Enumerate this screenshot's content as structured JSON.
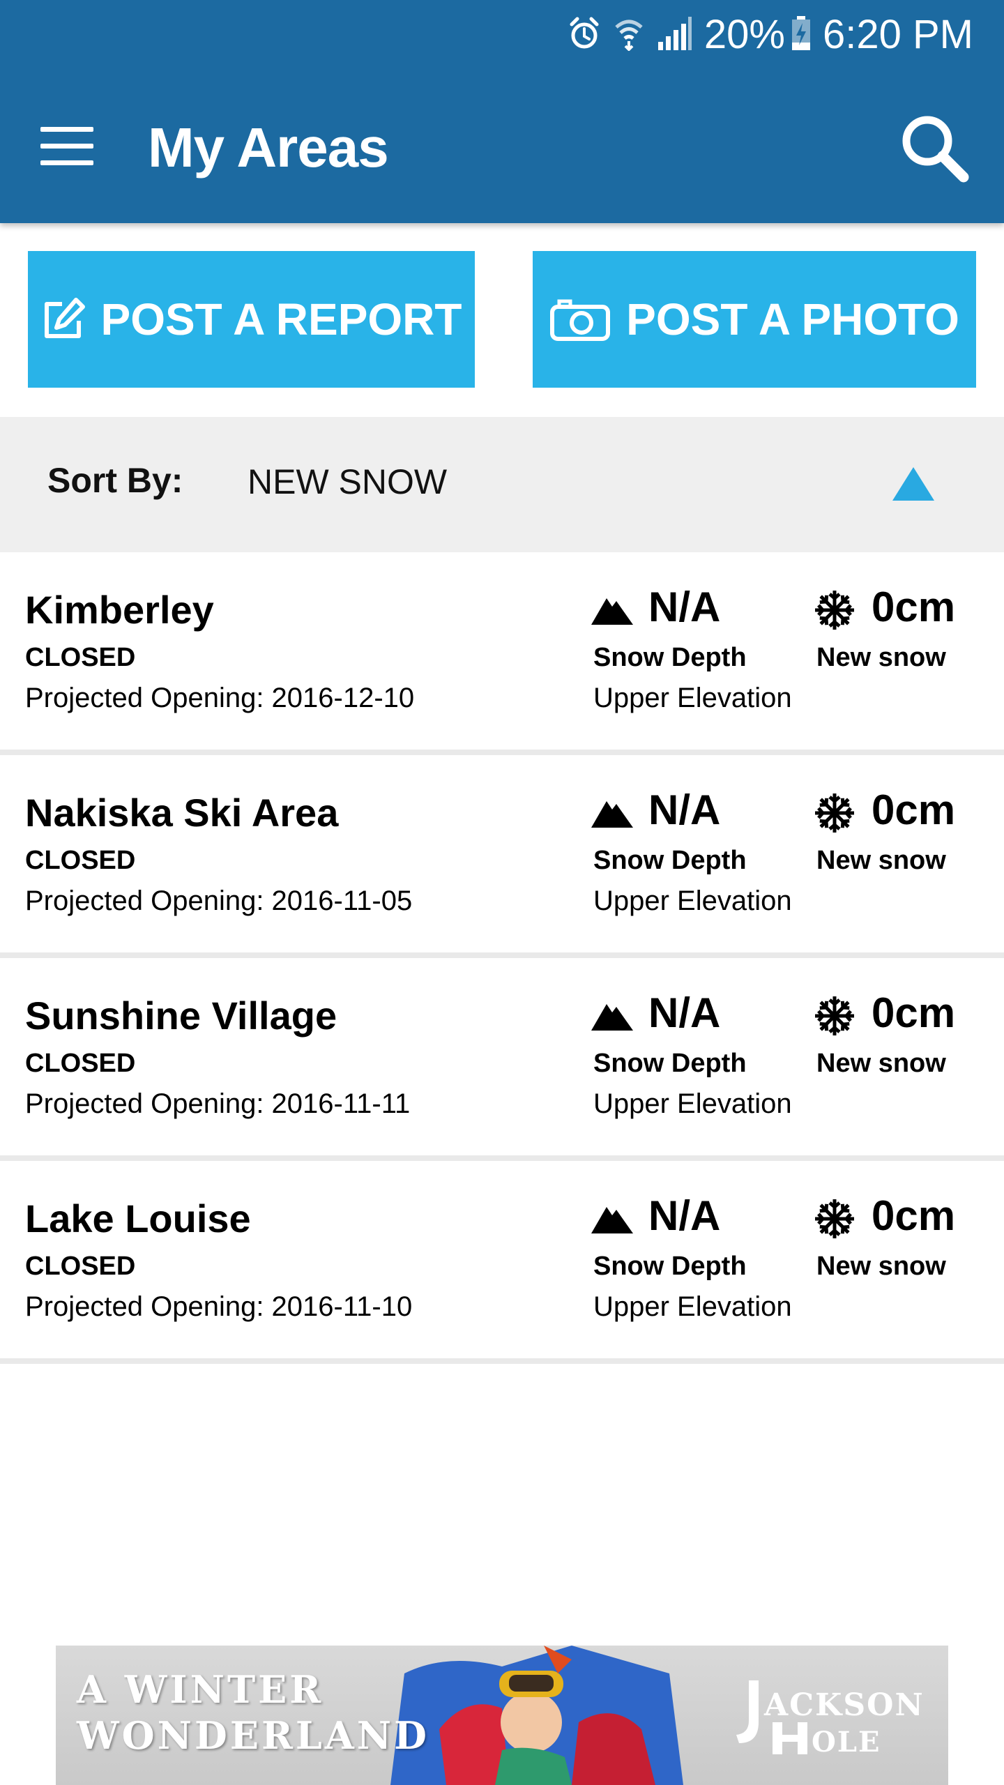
{
  "status_bar": {
    "battery": "20%",
    "time": "6:20 PM",
    "icons": [
      "alarm-icon",
      "wifi-icon",
      "signal-icon",
      "battery-charging-icon"
    ]
  },
  "toolbar": {
    "title": "My Areas",
    "menu_icon": "hamburger-menu-icon",
    "search_icon": "search-icon"
  },
  "actions": {
    "post_report": "POST A REPORT",
    "post_photo": "POST A PHOTO"
  },
  "sort": {
    "label": "Sort By:",
    "value": "NEW SNOW",
    "direction_icon": "triangle-up-icon"
  },
  "areas": [
    {
      "name": "Kimberley",
      "status": "CLOSED",
      "opening": "Projected Opening: 2016-12-10",
      "depth_value": "N/A",
      "depth_label": "Snow Depth",
      "depth_sub": "Upper Elevation",
      "snow_value": "0cm",
      "snow_label": "New snow"
    },
    {
      "name": "Nakiska Ski Area",
      "status": "CLOSED",
      "opening": "Projected Opening: 2016-11-05",
      "depth_value": "N/A",
      "depth_label": "Snow Depth",
      "depth_sub": "Upper Elevation",
      "snow_value": "0cm",
      "snow_label": "New snow"
    },
    {
      "name": "Sunshine Village",
      "status": "CLOSED",
      "opening": "Projected Opening: 2016-11-11",
      "depth_value": "N/A",
      "depth_label": "Snow Depth",
      "depth_sub": "Upper Elevation",
      "snow_value": "0cm",
      "snow_label": "New snow"
    },
    {
      "name": "Lake Louise",
      "status": "CLOSED",
      "opening": "Projected Opening: 2016-11-10",
      "depth_value": "N/A",
      "depth_label": "Snow Depth",
      "depth_sub": "Upper Elevation",
      "snow_value": "0cm",
      "snow_label": "New snow"
    }
  ],
  "ad": {
    "line1": "A WINTER",
    "line2": "WONDERLAND",
    "logo": "JACKSON HOLE"
  },
  "colors": {
    "app_bar": "#1c6aa1",
    "action_button": "#29b3e8",
    "sort_bar": "#efefef",
    "sort_arrow": "#29a9e1"
  }
}
